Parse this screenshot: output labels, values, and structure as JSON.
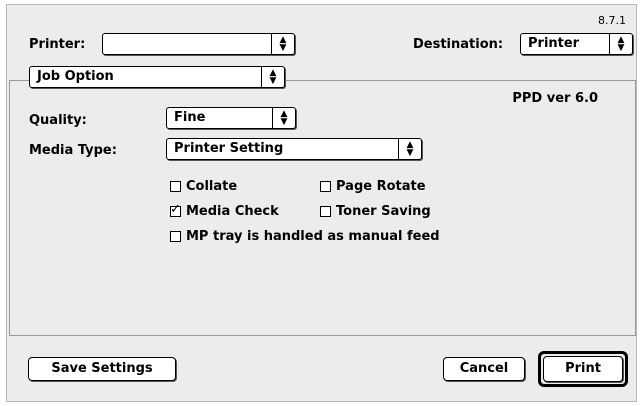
{
  "version": "8.7.1",
  "printer": {
    "label": "Printer:",
    "value": ""
  },
  "destination": {
    "label": "Destination:",
    "value": "Printer"
  },
  "panel_select": {
    "value": "Job Option"
  },
  "ppd_version": "PPD ver 6.0",
  "quality": {
    "label": "Quality:",
    "value": "Fine"
  },
  "media_type": {
    "label": "Media Type:",
    "value": "Printer Setting"
  },
  "checkboxes": [
    {
      "label": "Collate",
      "checked": false
    },
    {
      "label": "Page Rotate",
      "checked": false
    },
    {
      "label": "Media Check",
      "checked": true
    },
    {
      "label": "Toner Saving",
      "checked": false
    },
    {
      "label": "MP tray is handled as manual feed",
      "checked": false
    }
  ],
  "buttons": {
    "save_settings": "Save Settings",
    "cancel": "Cancel",
    "print": "Print"
  }
}
